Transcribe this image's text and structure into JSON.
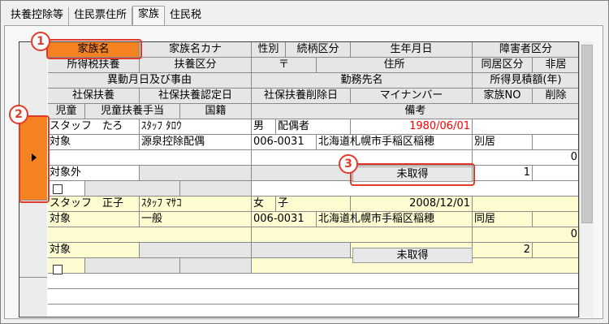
{
  "tabs": [
    {
      "label": "扶養控除等"
    },
    {
      "label": "住民票住所"
    },
    {
      "label": "家族"
    },
    {
      "label": "住民税"
    }
  ],
  "active_tab": "家族",
  "header": {
    "row1": {
      "kazoku_mei": "家族名",
      "kazoku_kana": "家族名カナ",
      "seibetsu": "性別",
      "zokugara": "続柄区分",
      "seinengappi": "生年月日",
      "shogaisha": "障害者区分"
    },
    "row2": {
      "shotokuzei_fuyo": "所得税扶養",
      "fuyo_kubun": "扶養区分",
      "yubin": "〒",
      "jusho": "住所",
      "dokyo": "同居区分",
      "hikyo": "非居"
    },
    "row3": {
      "ido": "異動月日及び事由",
      "kinmusaki": "勤務先名",
      "shotoku_mitsumori": "所得見積額(年)"
    },
    "row4": {
      "shaho_fuyo": "社保扶養",
      "shaho_nintei": "社保扶養認定日",
      "shaho_sakujo": "社保扶養削除日",
      "mynumber": "マイナンバー",
      "kazoku_no": "家族NO",
      "sakujo": "削除"
    },
    "row5": {
      "jido": "児童",
      "jido_teate": "児童扶養手当",
      "kokuseki": "国籍",
      "biko": "備考"
    }
  },
  "records": [
    {
      "name": "スタッフ　たろ",
      "kana": "ｽﾀｯﾌ ﾀﾛｳ",
      "seibetsu": "男",
      "zokugara": "配偶者",
      "birth": "1980/06/01",
      "shotokuzei": "対象",
      "fuyo_kubun": "源泉控除配偶",
      "yubin": "006-0031",
      "jusho": "北海道札幌市手稲区稲穂",
      "dokyo": "別居",
      "mitsumori": "0",
      "shaho": "対象外",
      "mynumber": "未取得",
      "kazoku_no": "1"
    },
    {
      "name": "スタッフ　正子",
      "kana": "ｽﾀｯﾌ ﾏｻｺ",
      "seibetsu": "女",
      "zokugara": "子",
      "birth": "2008/12/01",
      "shotokuzei": "対象",
      "fuyo_kubun": "一般",
      "yubin": "006-0031",
      "jusho": "北海道札幌市手稲区稲穂",
      "dokyo": "同居",
      "mitsumori": "0",
      "shaho": "対象",
      "mynumber": "未取得",
      "kazoku_no": "2"
    }
  ],
  "callouts": [
    "1",
    "2",
    "3"
  ],
  "colors": {
    "highlight": "#f58220",
    "callout": "#e23a2a",
    "row_alt": "#fdfbd0",
    "birth_red": "#ff0000"
  }
}
